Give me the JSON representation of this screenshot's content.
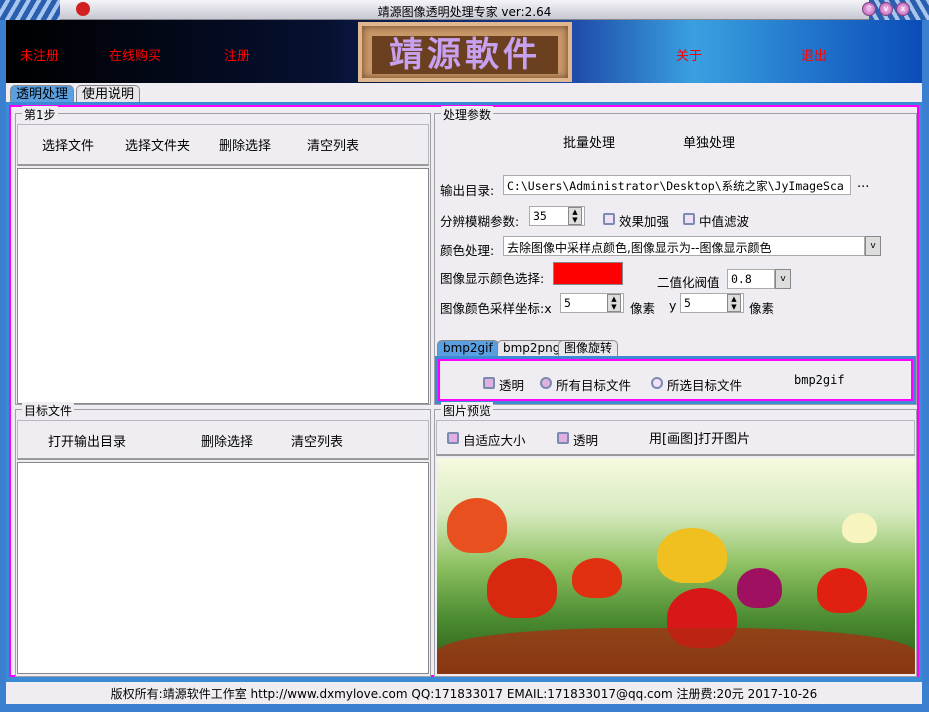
{
  "window": {
    "title": "靖源图像透明处理专家 ver:2.64"
  },
  "banner": {
    "unregistered": "未注册",
    "buy_online": "在线购买",
    "register": "注册",
    "logo": "靖源軟件",
    "about": "关于",
    "exit": "退出"
  },
  "tabs": [
    "透明处理",
    "使用说明"
  ],
  "step1": {
    "title": "第1步",
    "buttons": [
      "选择文件",
      "选择文件夹",
      "删除选择",
      "清空列表"
    ]
  },
  "target": {
    "title": "目标文件",
    "buttons": [
      "打开输出目录",
      "删除选择",
      "清空列表"
    ]
  },
  "params": {
    "title": "处理参数",
    "batch": "批量处理",
    "single": "单独处理",
    "output_dir_label": "输出目录:",
    "output_dir": "C:\\Users\\Administrator\\Desktop\\系统之家\\JyImageSca",
    "browse": "...",
    "blur_label": "分辨模糊参数:",
    "blur_value": "35",
    "enhance": "效果加强",
    "median": "中值滤波",
    "color_label": "颜色处理:",
    "color_value": "去除图像中采样点颜色,图像显示为--图像显示颜色",
    "display_color_label": "图像显示颜色选择:",
    "display_color": "#ff0000",
    "threshold_label": "二值化阀值",
    "threshold_value": "0.8",
    "sample_label": "图像颜色采样坐标:x",
    "x_value": "5",
    "pixel1": "像素",
    "y_label": "y",
    "y_value": "5",
    "pixel2": "像素"
  },
  "subtabs": [
    "bmp2gif",
    "bmp2png",
    "图像旋转"
  ],
  "bmp2gif": {
    "transparent": "透明",
    "all_targets": "所有目标文件",
    "selected_targets": "所选目标文件",
    "run": "bmp2gif"
  },
  "preview": {
    "title": "图片预览",
    "fit": "自适应大小",
    "transparent": "透明",
    "open_paint": "用[画图]打开图片"
  },
  "footer": "版权所有:靖源软件工作室 http://www.dxmylove.com QQ:171833017 EMAIL:171833017@qq.com 注册费:20元 2017-10-26"
}
